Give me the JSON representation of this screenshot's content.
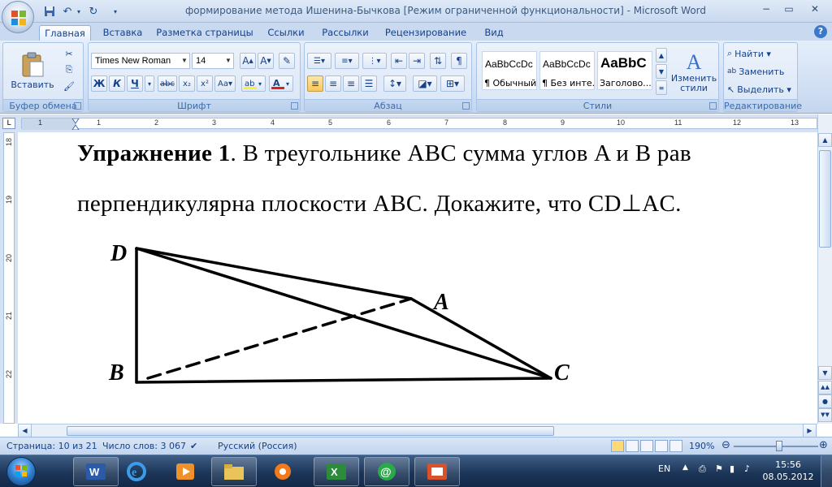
{
  "window": {
    "title": "формирование метода Ишенина-Бычкова [Режим ограниченной функциональности] - Microsoft Word",
    "minimize": "−",
    "maximize": "▭",
    "close": "✕"
  },
  "tabs": [
    "Главная",
    "Вставка",
    "Разметка страницы",
    "Ссылки",
    "Рассылки",
    "Рецензирование",
    "Вид"
  ],
  "ribbon": {
    "clipboard": {
      "label": "Буфер обмена",
      "paste": "Вставить"
    },
    "font": {
      "label": "Шрифт",
      "family": "Times New Roman",
      "size": "14"
    },
    "paragraph": {
      "label": "Абзац"
    },
    "styles": {
      "label": "Стили",
      "tiles": [
        {
          "sample": "AaBbCcDc",
          "name": "¶ Обычный"
        },
        {
          "sample": "AaBbCcDc",
          "name": "¶ Без инте..."
        },
        {
          "sample": "AaBbC",
          "name": "Заголово..."
        }
      ],
      "change": "Изменить стили"
    },
    "editing": {
      "label": "Редактирование",
      "find": "Найти",
      "replace": "Заменить",
      "select": "Выделить"
    }
  },
  "ruler": {
    "h_numbers": [
      "1",
      "1",
      "2",
      "3",
      "4",
      "5",
      "6",
      "7",
      "8",
      "9",
      "10",
      "11",
      "12",
      "13"
    ],
    "v_numbers": [
      "18",
      "19",
      "20",
      "21",
      "22"
    ]
  },
  "document": {
    "line1_bold": "Упражнение 1",
    "line1_rest": ". В треугольнике ABC сумма углов A и B рав",
    "line2": "перпендикулярна плоскости ABC. Докажите, что CD⊥AC.",
    "figure": {
      "points": [
        "D",
        "A",
        "B",
        "C"
      ]
    }
  },
  "statusbar": {
    "page": "Страница: 10 из 21",
    "words": "Число слов: 3 067",
    "language": "Русский (Россия)",
    "zoom": "190%",
    "zoom_level_percent": 190
  },
  "taskbar": {
    "lang": "EN",
    "time": "15:56",
    "date": "08.05.2012"
  }
}
